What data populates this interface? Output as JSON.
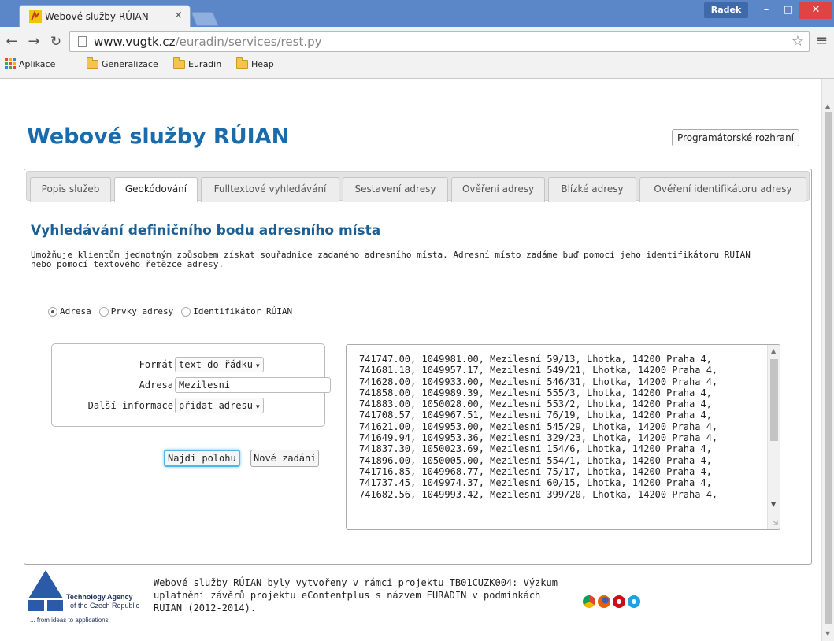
{
  "browser": {
    "tab_title": "Webové služby RÚIAN",
    "tab_close": "×",
    "user_name": "Radek",
    "url_host": "www.vugtk.cz",
    "url_path": "/euradin/services/rest.py",
    "bookmarks": [
      "Aplikace",
      "Generalizace",
      "Euradin",
      "Heap"
    ]
  },
  "page": {
    "title": "Webové služby RÚIAN",
    "api_button": "Programátorské rozhraní",
    "tabs": [
      "Popis služeb",
      "Geokódování",
      "Fulltextové vyhledávání",
      "Sestavení adresy",
      "Ověření adresy",
      "Blízké adresy",
      "Ověření identifikátoru adresy"
    ],
    "active_tab": "Geokódování",
    "section_title": "Vyhledávání definičního bodu adresního místa",
    "description_line1": "Umožňuje klientům jednotným způsobem získat souřadnice zadaného adresního místa. Adresní místo zadáme buď pomocí jeho identifikátoru RÚIAN",
    "description_line2": "nebo pomocí textového řetězce adresy.",
    "radios": [
      {
        "label": "Adresa",
        "checked": true
      },
      {
        "label": "Prvky adresy",
        "checked": false
      },
      {
        "label": "Identifikátor RÚIAN",
        "checked": false
      }
    ],
    "form": {
      "format_label": "Formát",
      "format_value": "text do řádku",
      "address_label": "Adresa",
      "address_value": "Mezilesní",
      "info_label": "Další informace",
      "info_value": "přidat adresu"
    },
    "buttons": {
      "find": "Najdi polohu",
      "new": "Nové zadání"
    },
    "results": [
      "741747.00, 1049981.00, Mezilesní 59/13, Lhotka, 14200 Praha 4,",
      "741681.18, 1049957.17, Mezilesní 549/21, Lhotka, 14200 Praha 4,",
      "741628.00, 1049933.00, Mezilesní 546/31, Lhotka, 14200 Praha 4,",
      "741858.00, 1049989.39, Mezilesní 555/3, Lhotka, 14200 Praha 4,",
      "741883.00, 1050028.00, Mezilesní 553/2, Lhotka, 14200 Praha 4,",
      "741708.57, 1049967.51, Mezilesní 76/19, Lhotka, 14200 Praha 4,",
      "741621.00, 1049953.00, Mezilesní 545/29, Lhotka, 14200 Praha 4,",
      "741649.94, 1049953.36, Mezilesní 329/23, Lhotka, 14200 Praha 4,",
      "741837.30, 1050023.69, Mezilesní 154/6, Lhotka, 14200 Praha 4,",
      "741896.00, 1050005.00, Mezilesní 554/1, Lhotka, 14200 Praha 4,",
      "741716.85, 1049968.77, Mezilesní 75/17, Lhotka, 14200 Praha 4,",
      "741737.45, 1049974.37, Mezilesní 60/15, Lhotka, 14200 Praha 4,",
      "741682.56, 1049993.42, Mezilesní 399/20, Lhotka, 14200 Praha 4,"
    ],
    "footer_text": "Webové služby RÚIAN byly vytvořeny v rámci projektu TB01CUZK004: Výzkum uplatnění závěrů projektu eContentplus s názvem EURADIN v podmínkách RUIAN (2012-2014).",
    "logo": {
      "line1": "Technology Agency",
      "line2": "of the Czech Republic",
      "line3": "... from ideas to applications"
    }
  },
  "colors": {
    "accent": "#1a6bab",
    "titlebar": "#5b87c8",
    "close_button": "#e04343"
  },
  "browser_icons": [
    "chrome-icon",
    "firefox-icon",
    "opera-icon",
    "ie-icon"
  ]
}
